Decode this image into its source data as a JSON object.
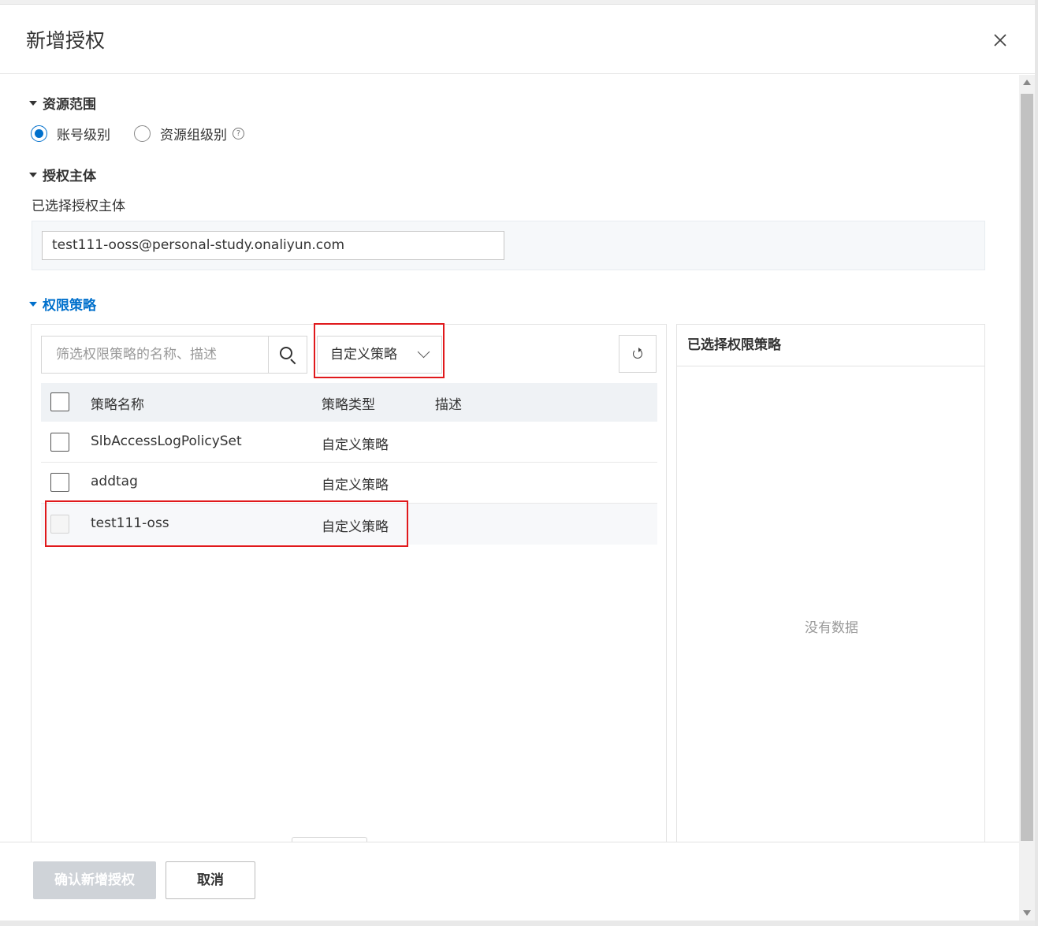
{
  "dialog": {
    "title": "新增授权",
    "close_icon": "close-icon"
  },
  "resource_scope": {
    "heading": "资源范围",
    "options": [
      {
        "label": "账号级别",
        "checked": true
      },
      {
        "label": "资源组级别",
        "checked": false
      }
    ],
    "help_glyph": "?"
  },
  "principal": {
    "heading": "授权主体",
    "selected_label": "已选择授权主体",
    "value": "test111-ooss@personal-study.onaliyun.com"
  },
  "policy": {
    "heading": "权限策略",
    "search_placeholder": "筛选权限策略的名称、描述",
    "type_filter": "自定义策略",
    "columns": [
      "策略名称",
      "策略类型",
      "描述"
    ],
    "rows": [
      {
        "name": "SlbAccessLogPolicySet",
        "type": "自定义策略",
        "desc": ""
      },
      {
        "name": "addtag",
        "type": "自定义策略",
        "desc": ""
      },
      {
        "name": "test111-oss",
        "type": "自定义策略",
        "desc": ""
      }
    ],
    "selected_heading": "已选择权限策略",
    "empty_text": "没有数据"
  },
  "footer": {
    "confirm_label": "确认新增授权",
    "cancel_label": "取消"
  },
  "colors": {
    "accent": "#0070cc",
    "annotation_red": "#e0191c",
    "disabled_button": "#cfd3d8"
  }
}
